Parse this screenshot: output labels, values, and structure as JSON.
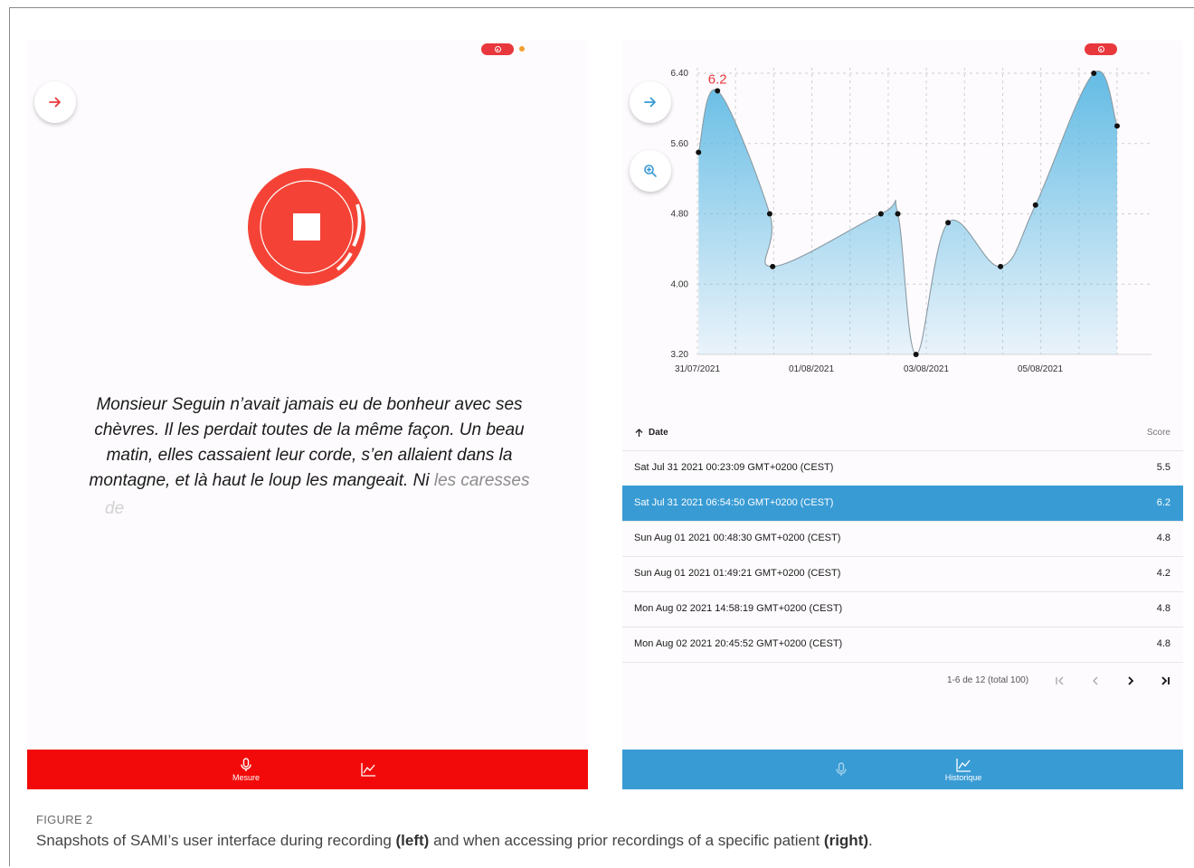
{
  "left_screen": {
    "reading_text_main": "Monsieur Seguin n’avait jamais eu de bonheur avec ses chèvres. Il les perdait toutes de la même façon. Un beau matin, elles cassaient leur corde, s’en allaient dans la montagne, et là haut le loup les mangeait. Ni",
    "reading_text_faded1": "les",
    "reading_text_faded2": "caresses",
    "reading_text_trailing": "de",
    "nav": {
      "measure_label": "Mesure"
    },
    "colors": {
      "accent": "#f20a0a",
      "record": "#f44336"
    },
    "icons": {
      "forward": "arrow-right-icon",
      "stop": "stop-icon",
      "mic": "mic-icon",
      "chart": "chart-icon"
    }
  },
  "right_screen": {
    "chart_data": {
      "type": "area",
      "x": [
        "2021-07-31 00:23",
        "2021-07-31 06:54",
        "2021-08-01 00:48",
        "2021-08-01 01:49",
        "2021-08-02 14:58",
        "2021-08-02 20:45",
        "2021-08-03 03:00",
        "2021-08-03 14:00",
        "2021-08-04 08:00",
        "2021-08-04 20:00",
        "2021-08-05 16:00",
        "2021-08-06 00:00"
      ],
      "values": [
        5.5,
        6.2,
        4.8,
        4.2,
        4.8,
        4.8,
        3.2,
        4.7,
        4.2,
        4.9,
        6.4,
        5.8
      ],
      "y_ticks": [
        "6.40",
        "5.60",
        "4.80",
        "4.00",
        "3.20"
      ],
      "x_ticks": [
        "31/07/2021",
        "01/08/2021",
        "03/08/2021",
        "05/08/2021"
      ],
      "ylim": [
        3.2,
        6.4
      ],
      "highlight_label": "6.2",
      "grid": true,
      "fill_color": "#5bb8e3"
    },
    "table": {
      "col_date": "Date",
      "col_score": "Score",
      "rows": [
        {
          "date": "Sat Jul 31 2021 00:23:09 GMT+0200 (CEST)",
          "score": "5.5"
        },
        {
          "date": "Sat Jul 31 2021 06:54:50 GMT+0200 (CEST)",
          "score": "6.2"
        },
        {
          "date": "Sun Aug 01 2021 00:48:30 GMT+0200 (CEST)",
          "score": "4.8"
        },
        {
          "date": "Sun Aug 01 2021 01:49:21 GMT+0200 (CEST)",
          "score": "4.2"
        },
        {
          "date": "Mon Aug 02 2021 14:58:19 GMT+0200 (CEST)",
          "score": "4.8"
        },
        {
          "date": "Mon Aug 02 2021 20:45:52 GMT+0200 (CEST)",
          "score": "4.8"
        }
      ],
      "pagination": "1-6 de 12 (total 100)"
    },
    "nav": {
      "history_label": "Historique"
    },
    "colors": {
      "accent": "#389bd4"
    },
    "icons": {
      "forward": "arrow-right-icon",
      "zoom": "zoom-in-icon",
      "mic": "mic-icon",
      "chart": "chart-icon"
    }
  },
  "caption": {
    "label": "FIGURE 2",
    "text_part1": "Snapshots of SAMI’s user interface during recording ",
    "text_bold1": "(left)",
    "text_part2": " and when accessing prior recordings of a specific patient ",
    "text_bold2": "(right)",
    "text_part3": "."
  }
}
